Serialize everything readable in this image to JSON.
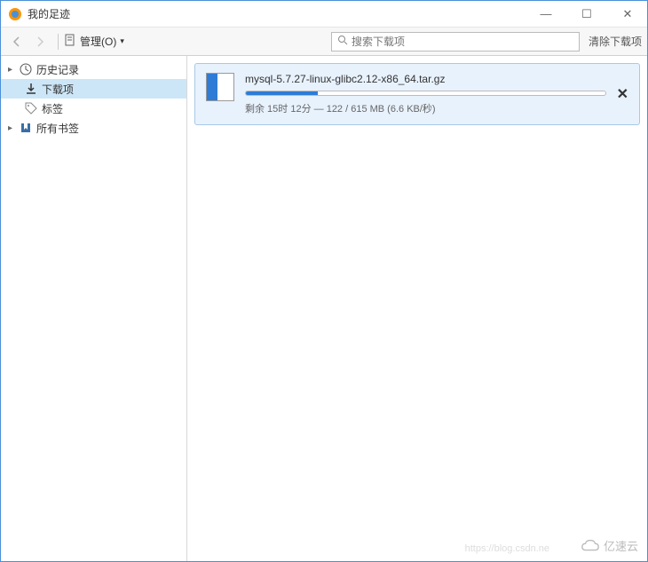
{
  "window": {
    "title": "我的足迹"
  },
  "toolbar": {
    "organize_label": "管理(O)",
    "search_placeholder": "搜索下载项",
    "clear_label": "清除下载项"
  },
  "sidebar": {
    "items": [
      {
        "label": "历史记录",
        "icon": "clock",
        "expandable": true
      },
      {
        "label": "下载项",
        "icon": "download",
        "selected": true,
        "child": true
      },
      {
        "label": "标签",
        "icon": "tag",
        "child": true
      },
      {
        "label": "所有书签",
        "icon": "bookmark",
        "expandable": true
      }
    ]
  },
  "download": {
    "filename": "mysql-5.7.27-linux-glibc2.12-x86_64.tar.gz",
    "progress_pct": 20,
    "status": "剩余 15时 12分 — 122 / 615 MB (6.6 KB/秒)"
  },
  "watermark": {
    "text": "亿速云",
    "faint": "https://blog.csdn.ne"
  }
}
